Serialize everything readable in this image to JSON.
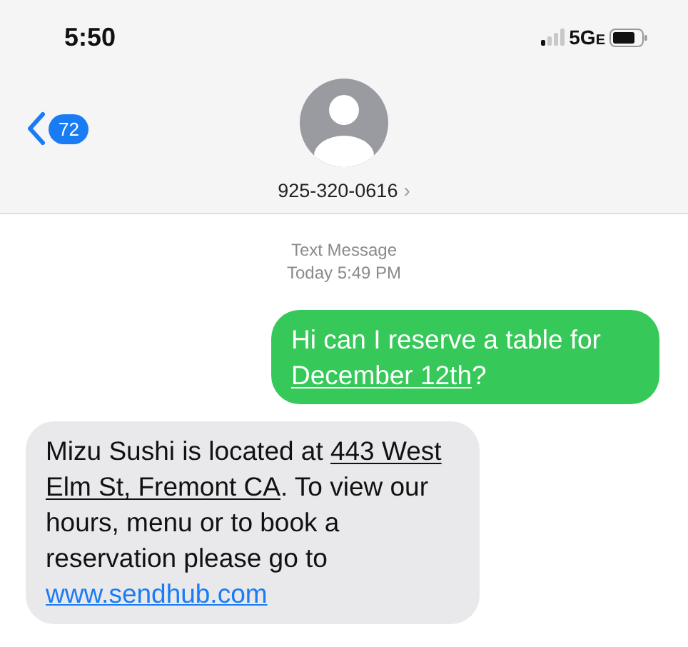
{
  "status_bar": {
    "time": "5:50",
    "network": "5G",
    "network_suffix": "E"
  },
  "header": {
    "back_badge": "72",
    "contact": "925-320-0616",
    "contact_chevron": "›"
  },
  "thread": {
    "service": "Text Message",
    "timestamp": "Today 5:49 PM",
    "messages": [
      {
        "kind": "sent",
        "parts": [
          {
            "kind": "plain",
            "text": "Hi can I reserve a table for "
          },
          {
            "kind": "detected",
            "text": "December 12th"
          },
          {
            "kind": "plain",
            "text": "?"
          }
        ]
      },
      {
        "kind": "received",
        "parts": [
          {
            "kind": "plain",
            "text": "Mizu Sushi is located at "
          },
          {
            "kind": "detected",
            "text": "443 West Elm St, Fremont CA"
          },
          {
            "kind": "plain",
            "text": ". To view our hours, menu or to book a reservation please go to "
          },
          {
            "kind": "link",
            "text": "www.sendhub.com"
          }
        ]
      }
    ]
  }
}
